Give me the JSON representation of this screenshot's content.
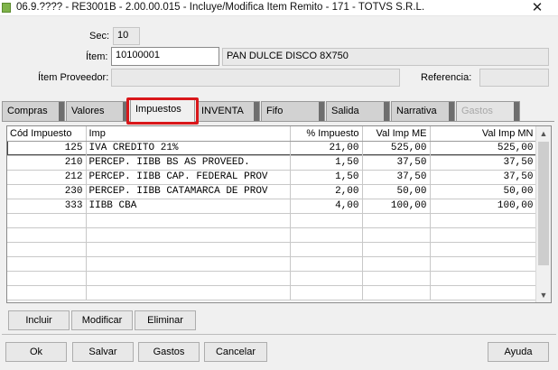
{
  "window": {
    "title": "06.9.???? - RE3001B - 2.00.00.015 - Incluye/Modifica Item Remito - 171 - TOTVS S.R.L.",
    "close_glyph": "✕"
  },
  "form": {
    "sec_label": "Sec:",
    "sec_value": "10",
    "item_label": "Ítem:",
    "item_value": "10100001",
    "item_description": "PAN DULCE DISCO 8X750",
    "item_proveedor_label": "Ítem Proveedor:",
    "item_proveedor_value": "",
    "referencia_label": "Referencia:",
    "referencia_value": ""
  },
  "tabs": [
    {
      "label": "Compras"
    },
    {
      "label": "Valores"
    },
    {
      "label": "Impuestos"
    },
    {
      "label": "INVENTA"
    },
    {
      "label": "Fifo"
    },
    {
      "label": "Salida"
    },
    {
      "label": "Narrativa"
    },
    {
      "label": "Gastos"
    }
  ],
  "active_tab": "Impuestos",
  "grid": {
    "columns": [
      "Cód Impuesto",
      "Imp",
      "% Impuesto",
      "Val Imp ME",
      "Val Imp MN"
    ],
    "rows": [
      {
        "cod": "125",
        "imp": "IVA CREDITO 21%",
        "pct": "21,00",
        "me": "525,00",
        "mn": "525,00"
      },
      {
        "cod": "210",
        "imp": "PERCEP. IIBB BS AS PROVEED.",
        "pct": "1,50",
        "me": "37,50",
        "mn": "37,50"
      },
      {
        "cod": "212",
        "imp": "PERCEP. IIBB CAP. FEDERAL PROV",
        "pct": "1,50",
        "me": "37,50",
        "mn": "37,50"
      },
      {
        "cod": "230",
        "imp": "PERCEP. IIBB CATAMARCA DE PROV",
        "pct": "2,00",
        "me": "50,00",
        "mn": "50,00"
      },
      {
        "cod": "333",
        "imp": "IIBB CBA",
        "pct": "4,00",
        "me": "100,00",
        "mn": "100,00"
      }
    ],
    "empty_rows": 6,
    "scroll_up": "▲",
    "scroll_down": "▼"
  },
  "grid_buttons": {
    "incluir": "Incluir",
    "modificar": "Modificar",
    "eliminar": "Eliminar"
  },
  "footer_buttons": {
    "ok": "Ok",
    "salvar": "Salvar",
    "gastos": "Gastos",
    "cancelar": "Cancelar",
    "ayuda": "Ayuda"
  },
  "colors": {
    "highlight": "#d9171a",
    "tab_bg": "#d2d2d2",
    "window_bg": "#f0f0f0"
  }
}
